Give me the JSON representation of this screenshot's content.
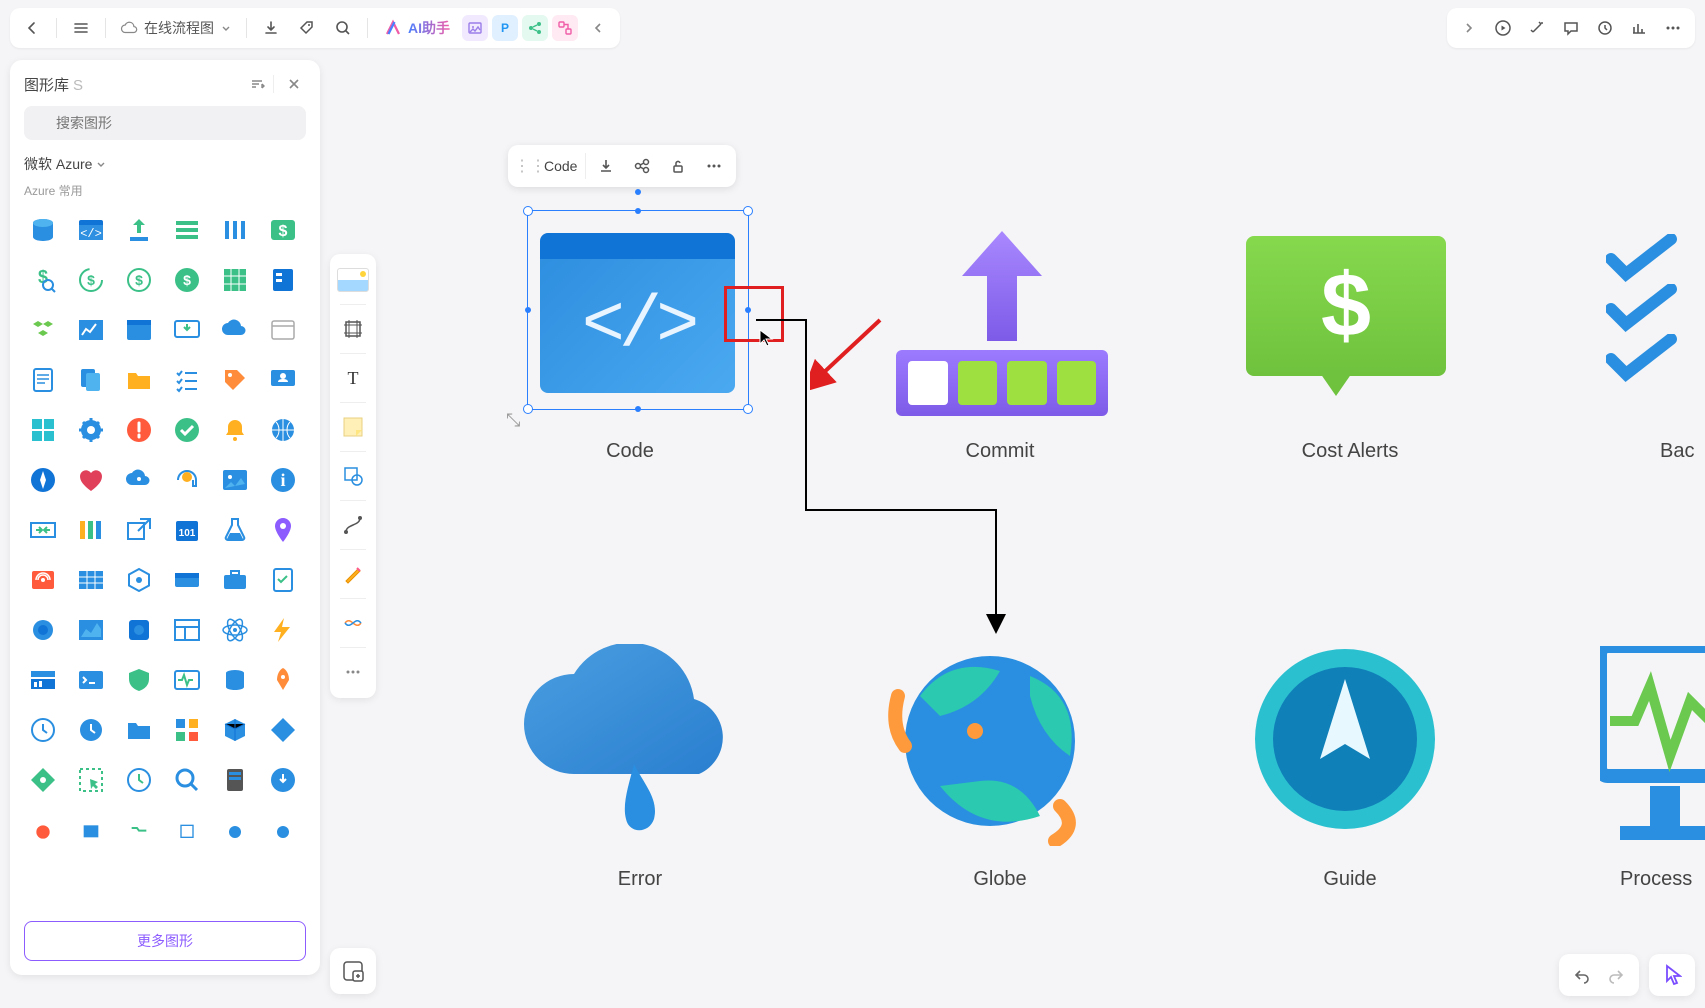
{
  "toolbar": {
    "title": "在线流程图",
    "ai_label": "AI助手"
  },
  "panel": {
    "title": "图形库",
    "shortcut": "S",
    "search_placeholder": "搜索图形",
    "category": "微软 Azure",
    "subcategory": "Azure 常用",
    "more_btn": "更多图形"
  },
  "ctx": {
    "shape_name": "Code"
  },
  "shapes": {
    "code": "Code",
    "commit": "Commit",
    "cost_alerts": "Cost Alerts",
    "backlog": "Bac",
    "error": "Error",
    "globe": "Globe",
    "guide": "Guide",
    "process": "Process"
  },
  "icons": {
    "cost_sign": "$"
  }
}
